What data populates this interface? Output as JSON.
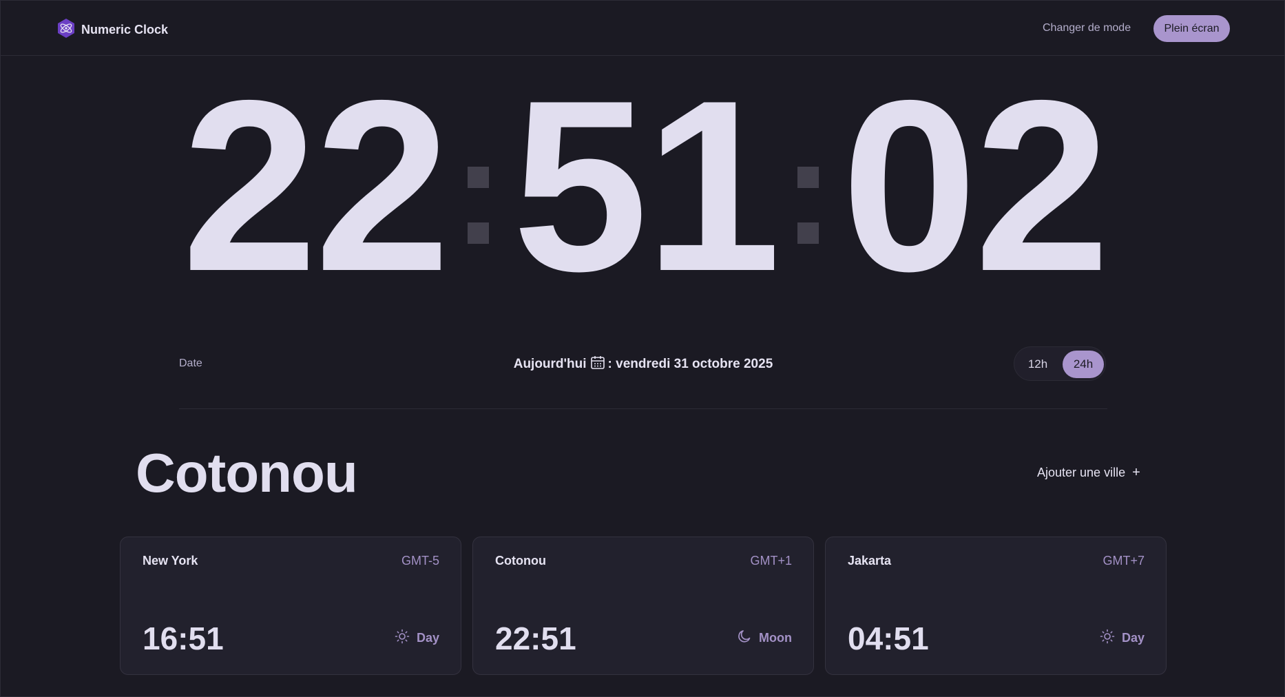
{
  "header": {
    "app_name": "Numeric Clock",
    "mode_label": "Changer de mode",
    "fullscreen_label": "Plein écran"
  },
  "clock": {
    "hours": "22",
    "minutes": "51",
    "seconds": "02"
  },
  "date_row": {
    "label": "Date",
    "today_prefix": "Aujourd'hui",
    "today_value": ": vendredi 31 octobre 2025",
    "format_options": [
      "12h",
      "24h"
    ],
    "selected_format": "24h"
  },
  "city_section": {
    "current_city": "Cotonou",
    "add_city_label": "Ajouter une ville",
    "add_icon": "+"
  },
  "cards": [
    {
      "city": "New York",
      "gmt": "GMT-5",
      "time": "16:51",
      "status": "Day",
      "icon": "sun-icon"
    },
    {
      "city": "Cotonou",
      "gmt": "GMT+1",
      "time": "22:51",
      "status": "Moon",
      "icon": "moon-icon"
    },
    {
      "city": "Jakarta",
      "gmt": "GMT+7",
      "time": "04:51",
      "status": "Day",
      "icon": "sun-icon"
    }
  ],
  "colors": {
    "background": "#1b1a23",
    "accent": "#a995cd",
    "text": "#e1deef",
    "muted": "#a391c6"
  }
}
